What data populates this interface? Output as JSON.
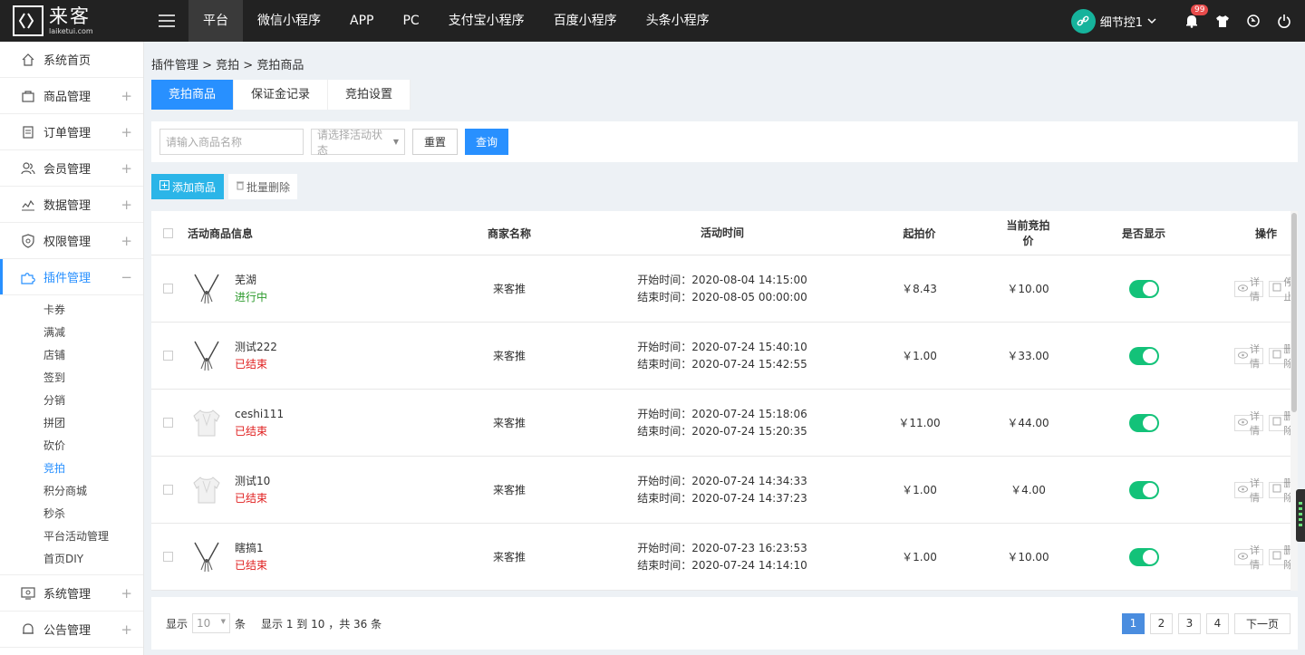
{
  "brand": {
    "name_cn": "来客",
    "name_en": "laiketui.com"
  },
  "topnav": {
    "tabs": [
      "平台",
      "微信小程序",
      "APP",
      "PC",
      "支付宝小程序",
      "百度小程序",
      "头条小程序"
    ],
    "user": "细节控1",
    "notifications": "99"
  },
  "sidebar": {
    "items": [
      {
        "label": "系统首页",
        "icon": "home-icon"
      },
      {
        "label": "商品管理",
        "icon": "bag-icon"
      },
      {
        "label": "订单管理",
        "icon": "clipboard-icon"
      },
      {
        "label": "会员管理",
        "icon": "users-icon"
      },
      {
        "label": "数据管理",
        "icon": "chart-icon"
      },
      {
        "label": "权限管理",
        "icon": "shield-icon"
      },
      {
        "label": "插件管理",
        "icon": "puzzle-icon"
      }
    ],
    "subitems": [
      "卡券",
      "满减",
      "店铺",
      "签到",
      "分销",
      "拼团",
      "砍价",
      "竞拍",
      "积分商城",
      "秒杀",
      "平台活动管理",
      "首页DIY"
    ],
    "bottom_items": [
      {
        "label": "系统管理",
        "icon": "monitor-icon"
      },
      {
        "label": "公告管理",
        "icon": "bell-icon"
      }
    ]
  },
  "breadcrumb": "插件管理 > 竞拍 > 竞拍商品",
  "tabs": [
    "竞拍商品",
    "保证金记录",
    "竞拍设置"
  ],
  "filter": {
    "name_placeholder": "请输入商品名称",
    "status_placeholder": "请选择活动状态",
    "reset": "重置",
    "query": "查询"
  },
  "actions": {
    "add": "添加商品",
    "batch_delete": "批量删除"
  },
  "table": {
    "headers": [
      "活动商品信息",
      "商家名称",
      "活动时间",
      "起拍价",
      "当前竞拍价",
      "是否显示",
      "操作"
    ],
    "rows": [
      {
        "name": "芜湖",
        "status": "进行中",
        "status_type": "on",
        "merchant": "来客推",
        "start": "开始时间：2020-08-04 14:15:00",
        "end": "结束时间：2020-08-05 00:00:00",
        "start_price": "￥8.43",
        "current_price": "￥10.00",
        "op1": "详情",
        "op2": "停止",
        "img": "necklace"
      },
      {
        "name": "测试222",
        "status": "已结束",
        "status_type": "off",
        "merchant": "来客推",
        "start": "开始时间：2020-07-24 15:40:10",
        "end": "结束时间：2020-07-24 15:42:55",
        "start_price": "￥1.00",
        "current_price": "￥33.00",
        "op1": "详情",
        "op2": "删除",
        "img": "necklace"
      },
      {
        "name": "ceshi111",
        "status": "已结束",
        "status_type": "off",
        "merchant": "来客推",
        "start": "开始时间：2020-07-24 15:18:06",
        "end": "结束时间：2020-07-24 15:20:35",
        "start_price": "￥11.00",
        "current_price": "￥44.00",
        "op1": "详情",
        "op2": "删除",
        "img": "shirt"
      },
      {
        "name": "测试10",
        "status": "已结束",
        "status_type": "off",
        "merchant": "来客推",
        "start": "开始时间：2020-07-24 14:34:33",
        "end": "结束时间：2020-07-24 14:37:23",
        "start_price": "￥1.00",
        "current_price": "￥4.00",
        "op1": "详情",
        "op2": "删除",
        "img": "shirt"
      },
      {
        "name": "瞎搞1",
        "status": "已结束",
        "status_type": "off",
        "merchant": "来客推",
        "start": "开始时间：2020-07-23 16:23:53",
        "end": "结束时间：2020-07-24 14:14:10",
        "start_price": "￥1.00",
        "current_price": "￥10.00",
        "op1": "详情",
        "op2": "删除",
        "img": "necklace"
      }
    ]
  },
  "pager": {
    "show": "显示",
    "page_size": "10",
    "unit": "条",
    "summary": "显示 1 到 10 ，共 36 条",
    "pages": [
      "1",
      "2",
      "3",
      "4"
    ],
    "next": "下一页"
  },
  "colors": {
    "primary": "#2890ff",
    "topbar": "#222222",
    "toggle_on": "#13c279",
    "status_on": "#2c9a2c",
    "status_off": "#e02020"
  }
}
